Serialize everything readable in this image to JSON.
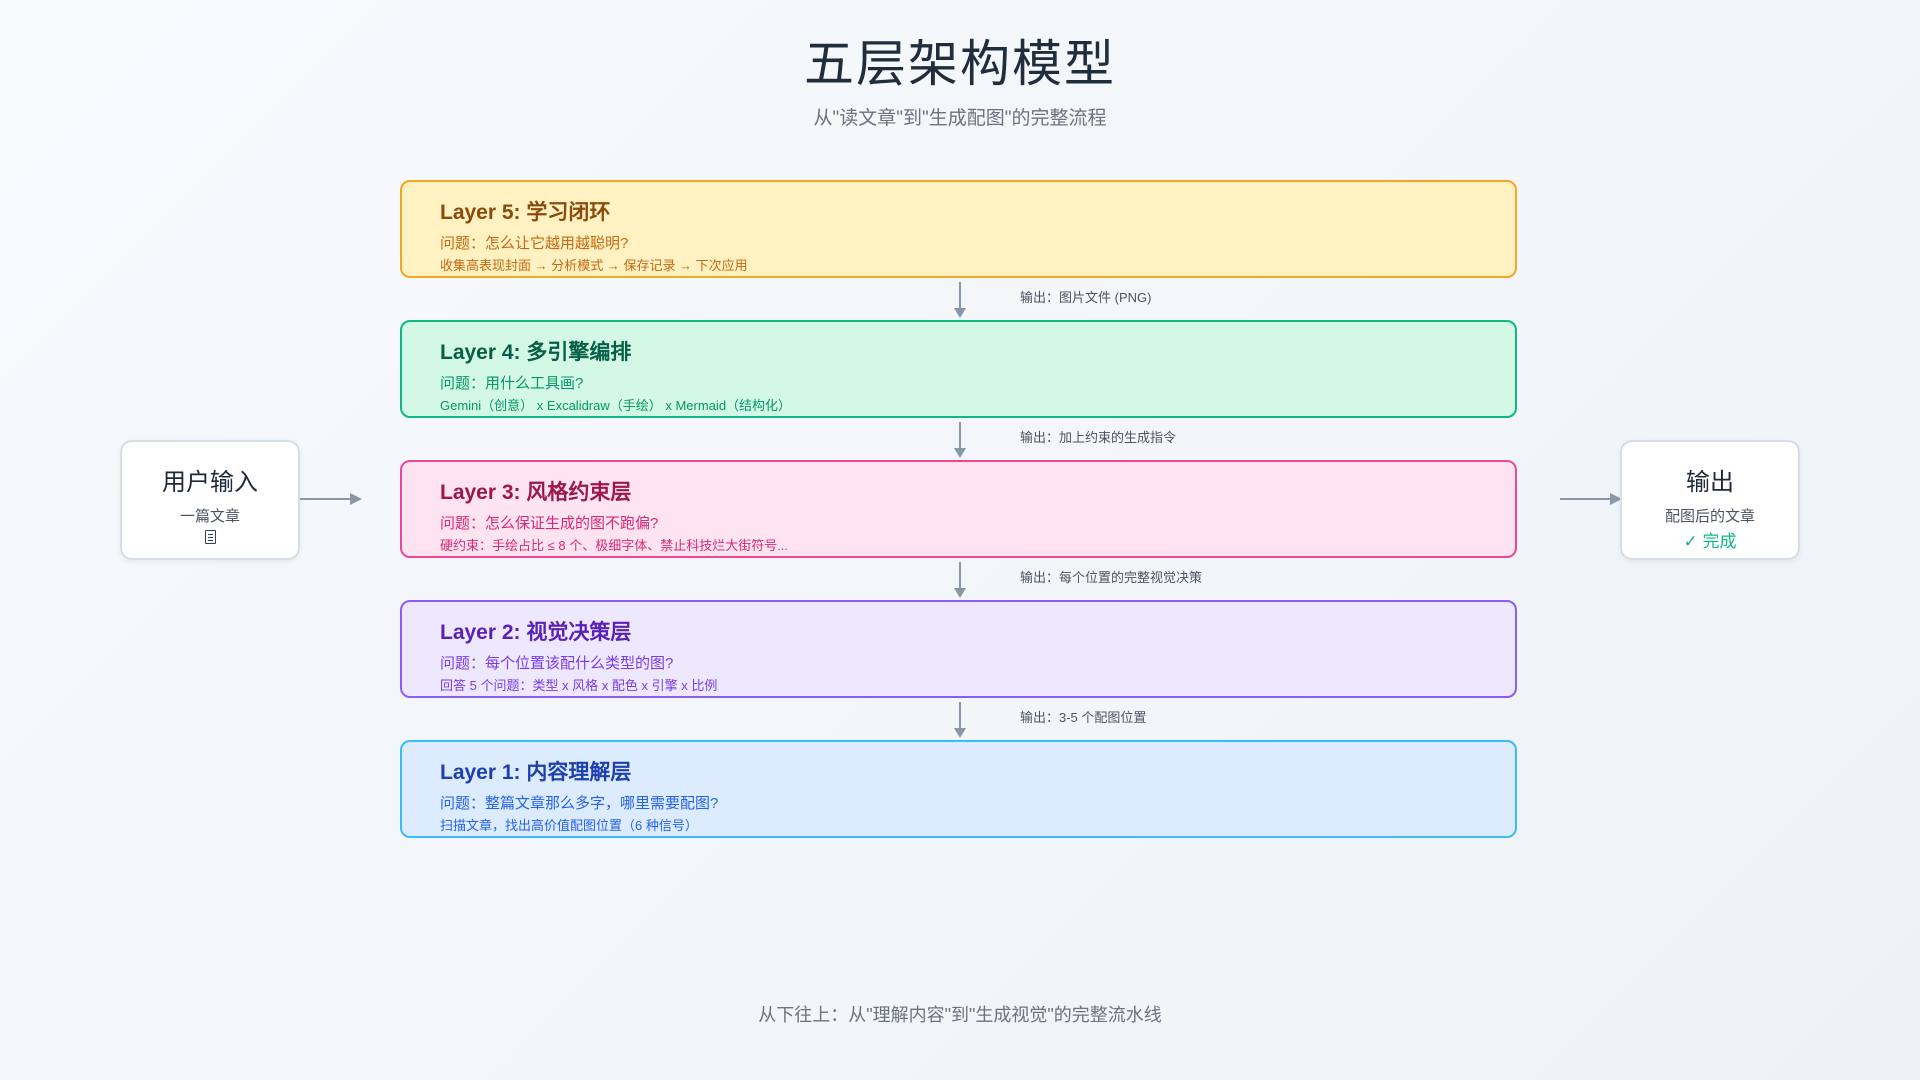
{
  "header": {
    "title": "五层架构模型",
    "subtitle": "从\"读文章\"到\"生成配图\"的完整流程"
  },
  "layers": [
    {
      "title": "Layer 5: 学习闭环",
      "question": "问题：怎么让它越用越聪明?",
      "detail": "收集高表现封面 → 分析模式 → 保存记录 → 下次应用",
      "colors": {
        "bg": "#fff1c2",
        "border": "#f5a623",
        "title": "#8a4b0c",
        "text": "#c46a10"
      }
    },
    {
      "title": "Layer 4: 多引擎编排",
      "question": "问题：用什么工具画?",
      "detail": "Gemini（创意） x Excalidraw（手绘） x Mermaid（结构化）",
      "colors": {
        "bg": "#d3f8e6",
        "border": "#10b981",
        "title": "#065f46",
        "text": "#059669"
      }
    },
    {
      "title": "Layer 3: 风格约束层",
      "question": "问题：怎么保证生成的图不跑偏?",
      "detail": "硬约束：手绘占比 ≤ 8 个、极细字体、禁止科技烂大街符号...",
      "colors": {
        "bg": "#fde4f0",
        "border": "#ec4899",
        "title": "#9d174d",
        "text": "#db2777"
      }
    },
    {
      "title": "Layer 2: 视觉决策层",
      "question": "问题：每个位置该配什么类型的图?",
      "detail": "回答 5 个问题：类型 x 风格 x 配色 x 引擎 x 比例",
      "colors": {
        "bg": "#ede8fd",
        "border": "#8b5cf6",
        "title": "#5b21b6",
        "text": "#7c3aed"
      }
    },
    {
      "title": "Layer 1: 内容理解层",
      "question": "问题：整篇文章那么多字，哪里需要配图?",
      "detail": "扫描文章，找出高价值配图位置（6 种信号）",
      "colors": {
        "bg": "#dcebfd",
        "border": "#38bdf8",
        "title": "#1e40af",
        "text": "#2563eb"
      }
    }
  ],
  "outputs": [
    "输出：图片文件 (PNG)",
    "输出：加上约束的生成指令",
    "输出：每个位置的完整视觉决策",
    "输出：3-5 个配图位置"
  ],
  "input_box": {
    "title": "用户输入",
    "subtitle": "一篇文章",
    "icon": "document-icon"
  },
  "output_box": {
    "title": "输出",
    "subtitle": "配图后的文章",
    "status": "✓ 完成",
    "status_color": "#10b981"
  },
  "footer": {
    "text": "从下往上：从\"理解内容\"到\"生成视觉\"的完整流水线"
  }
}
